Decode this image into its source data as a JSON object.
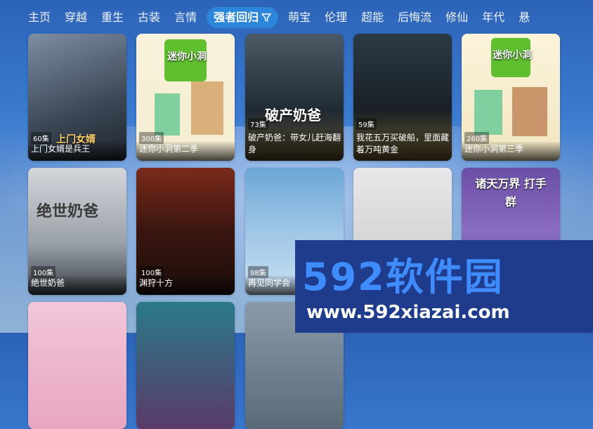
{
  "tabs": [
    "主页",
    "穿越",
    "重生",
    "古装",
    "言情",
    "强者回归",
    "萌宝",
    "伦理",
    "超能",
    "后悔流",
    "修仙",
    "年代",
    "悬"
  ],
  "active_tab_index": 5,
  "cards": [
    {
      "episodes": "60集",
      "title": "上门女婿是兵王",
      "poster_text": "上门女婿"
    },
    {
      "episodes": "300集",
      "title": "迷你小洞第二季",
      "poster_text": "迷你小洞"
    },
    {
      "episodes": "73集",
      "title": "破产奶爸：带女儿赶海翻身",
      "poster_text": "破产奶爸"
    },
    {
      "episodes": "59集",
      "title": "我花五万买破船，里面藏着万吨黄金",
      "poster_text": ""
    },
    {
      "episodes": "260集",
      "title": "迷你小洞第三季",
      "poster_text": "迷你小洞"
    },
    {
      "episodes": "100集",
      "title": "绝世奶爸",
      "poster_text": "绝世奶爸"
    },
    {
      "episodes": "100集",
      "title": "渊狩十方",
      "poster_text": ""
    },
    {
      "episodes": "98集",
      "title": "再见同学会",
      "poster_text": ""
    },
    {
      "episodes": "",
      "title": "",
      "poster_text": ""
    },
    {
      "episodes": "",
      "title": "",
      "poster_text": "诸天万界 打手群"
    }
  ],
  "watermark": {
    "logo": "592软件园",
    "url": "www.592xiazai.com"
  }
}
